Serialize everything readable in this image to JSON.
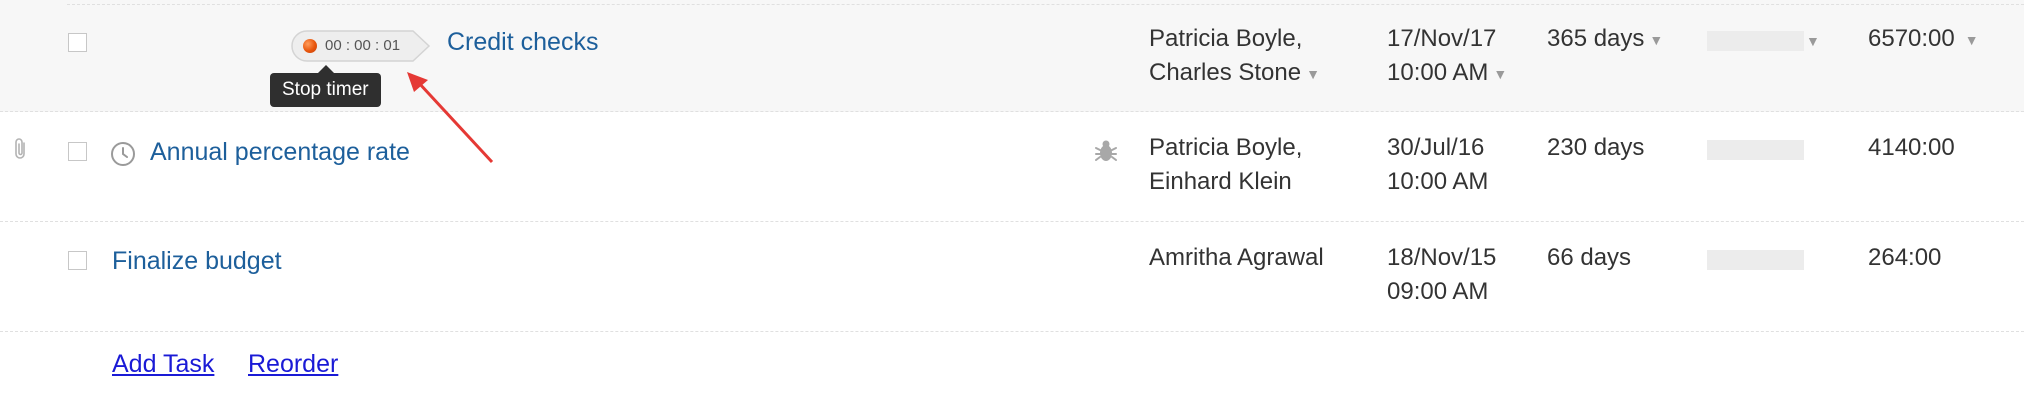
{
  "tasks": [
    {
      "name": "Credit checks",
      "owners": [
        "Patricia Boyle,",
        "Charles Stone"
      ],
      "date": "17/Nov/17",
      "time": "10:00 AM",
      "duration": "365 days",
      "work": "6570:00",
      "timer": "00 : 00 : 01",
      "timer_tooltip": "Stop timer"
    },
    {
      "name": "Annual percentage rate",
      "owners": [
        "Patricia Boyle,",
        "Einhard Klein"
      ],
      "date": "30/Jul/16",
      "time": "10:00 AM",
      "duration": "230 days",
      "work": "4140:00"
    },
    {
      "name": "Finalize budget",
      "owners": [
        "Amritha Agrawal"
      ],
      "date": "18/Nov/15",
      "time": "09:00 AM",
      "duration": "66 days",
      "work": "264:00"
    }
  ],
  "footer": {
    "add_task": "Add Task",
    "reorder": "Reorder"
  },
  "icons": {
    "attachment": "paperclip-icon",
    "recurring": "clock-icon",
    "issue": "bug-icon",
    "dropdown": "caret-down-icon"
  },
  "colors": {
    "link": "#1d5f9b",
    "footer_link": "#1a1ad6",
    "tooltip_bg": "#2f2f2f",
    "timer_dot": "#e8560d",
    "annotation_arrow": "#e53935",
    "selected_row_bg": "#f7f7f7"
  }
}
